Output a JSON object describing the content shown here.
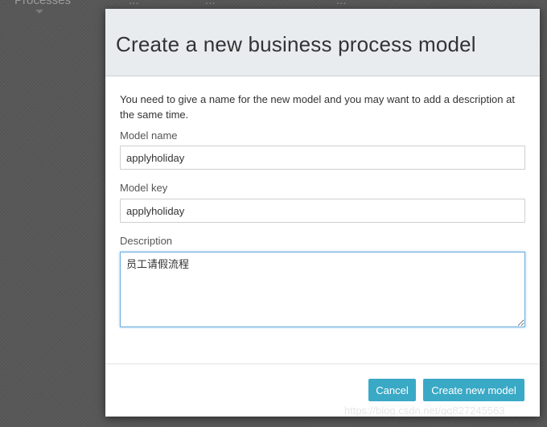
{
  "background": {
    "tabs": [
      "Processes",
      "...",
      "...",
      "..."
    ]
  },
  "modal": {
    "title": "Create a new business process model",
    "intro": "You need to give a name for the new model and you may want to add a description at the same time.",
    "model_name": {
      "label": "Model name",
      "value": "applyholiday"
    },
    "model_key": {
      "label": "Model key",
      "value": "applyholiday"
    },
    "description": {
      "label": "Description",
      "value": "员工请假流程"
    },
    "cancel_label": "Cancel",
    "create_label": "Create new model"
  },
  "watermark": "https://blog.csdn.net/qq827245563",
  "colors": {
    "accent": "#3aa9c6",
    "header_bg": "#e8ecef",
    "focus_border": "#6aaee0"
  }
}
